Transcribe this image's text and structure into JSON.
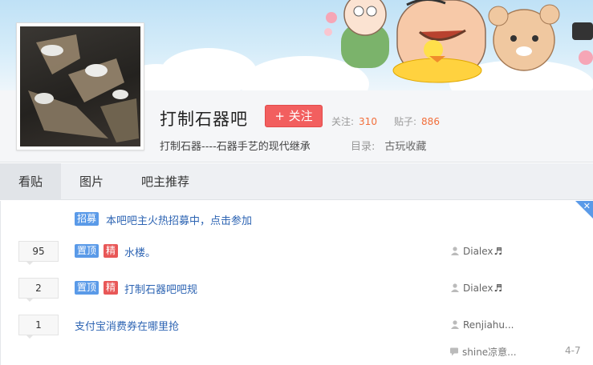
{
  "forum": {
    "name": "打制石器吧",
    "follow_label": "+ 关注",
    "followers_label": "关注:",
    "followers_count": "310",
    "posts_label": "贴子:",
    "posts_count": "886",
    "slogan": "打制石器----石器手艺的现代继承",
    "catalog_label": "目录:",
    "catalog_value": "古玩收藏"
  },
  "tabs": [
    {
      "label": "看贴",
      "active": true
    },
    {
      "label": "图片",
      "active": false
    },
    {
      "label": "吧主推荐",
      "active": false
    }
  ],
  "notice": {
    "tag": "招募",
    "text": "本吧吧主火热招募中，点击参加"
  },
  "threads": [
    {
      "replies": "95",
      "tags": [
        "置顶",
        "精"
      ],
      "title": "水楼。",
      "author": "Dialex",
      "author_note": "♬"
    },
    {
      "replies": "2",
      "tags": [
        "置顶",
        "精"
      ],
      "title": "打制石器吧吧规",
      "author": "Dialex",
      "author_note": "♬"
    },
    {
      "replies": "1",
      "tags": [],
      "title": "支付宝消费券在哪里抢",
      "author": "Renjiahu...",
      "author_note": ""
    }
  ],
  "last_reply": {
    "user": "shine凉意...",
    "time": "4-7"
  },
  "colors": {
    "accent_blue": "#5a9ae8",
    "tag_red": "#e85757",
    "follow_red": "#f25f5f",
    "count_orange": "#f26f3c",
    "link_blue": "#2d64b3"
  },
  "icons": {
    "user": "person-icon",
    "reply": "comment-icon",
    "close": "close-icon"
  }
}
